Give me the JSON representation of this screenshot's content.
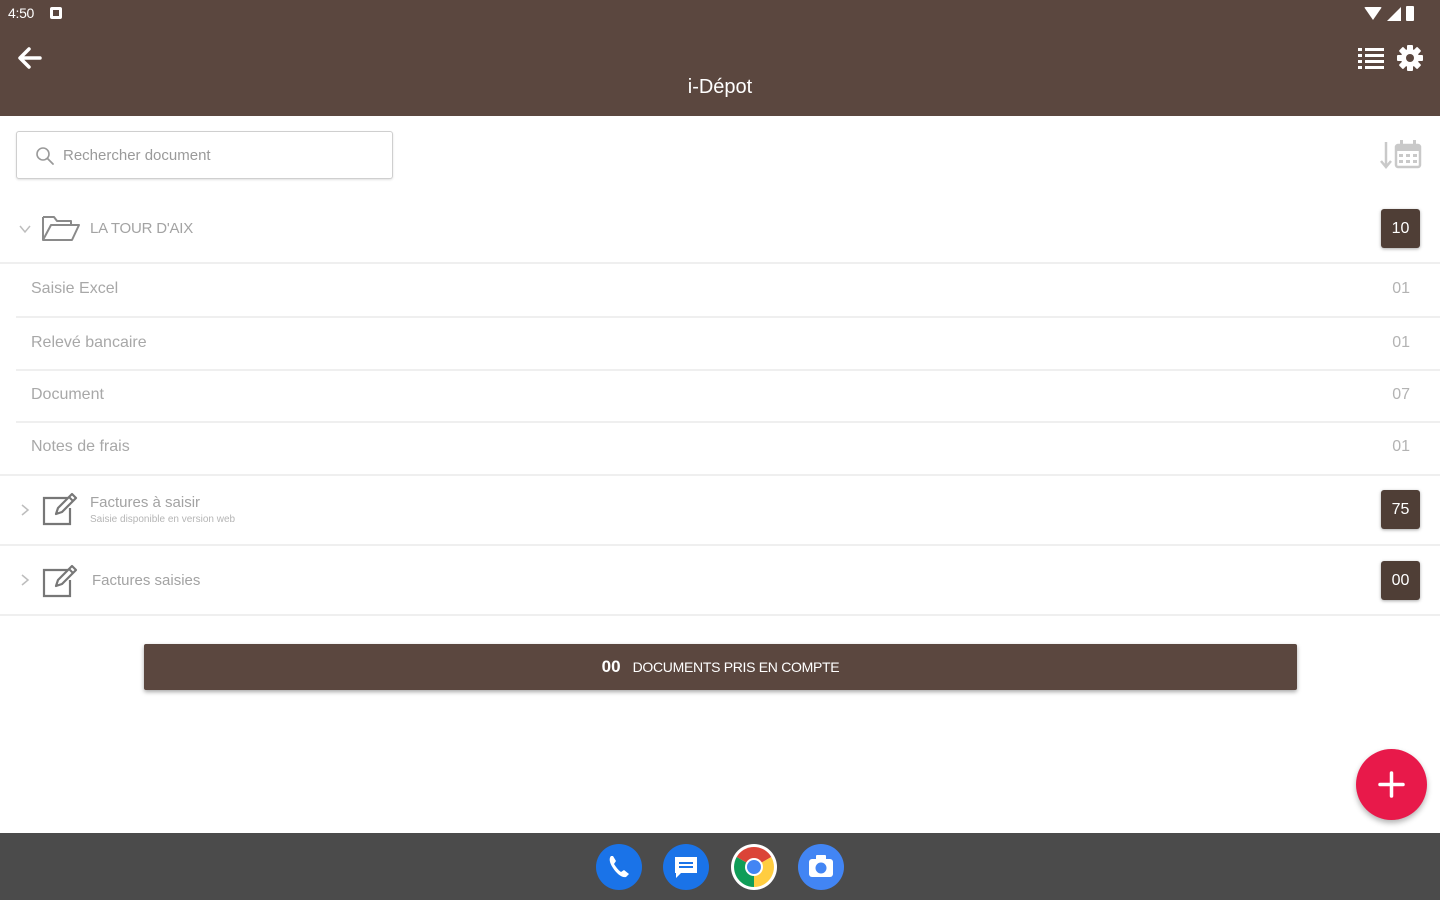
{
  "status_bar": {
    "time": "4:50"
  },
  "header": {
    "title": "i-Dépot"
  },
  "search": {
    "placeholder": "Rechercher document"
  },
  "folder": {
    "name": "LA TOUR D'AIX",
    "count": "10"
  },
  "sub_items": [
    {
      "label": "Saisie Excel",
      "count": "01"
    },
    {
      "label": "Relevé bancaire",
      "count": "01"
    },
    {
      "label": "Document",
      "count": "07"
    },
    {
      "label": "Notes de frais",
      "count": "01"
    }
  ],
  "factures_a_saisir": {
    "title": "Factures à saisir",
    "subtitle": "Saisie disponible en version web",
    "count": "75"
  },
  "factures_saisies": {
    "title": "Factures saisies",
    "count": "00"
  },
  "documents_bar": {
    "count": "00",
    "label": "DOCUMENTS PRIS EN COMPTE"
  },
  "colors": {
    "primary": "#5b473f",
    "badge": "#4f3e36",
    "fab": "#e8194a",
    "taskbar": "#4b4b4b"
  },
  "icons": {
    "back": "arrow-left-icon",
    "list": "list-icon",
    "settings": "gear-icon",
    "search": "search-icon",
    "sort": "sort-calendar-icon",
    "folder": "folder-open-icon",
    "edit": "edit-icon",
    "add": "plus-icon",
    "dock": [
      "phone-icon",
      "messages-icon",
      "chrome-icon",
      "camera-icon"
    ]
  }
}
